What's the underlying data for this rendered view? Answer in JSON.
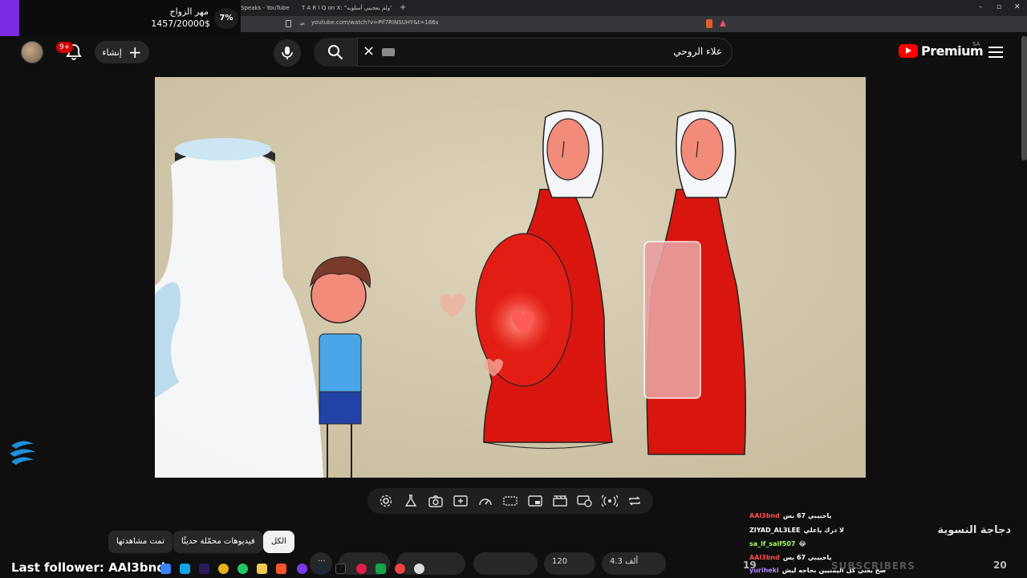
{
  "browser": {
    "tabs": [
      {
        "label": "Speaks - YouTube"
      },
      {
        "label": "T A R I Q on X: \"ولم يعجبني أسلوبه\""
      }
    ],
    "url": "youtube.com/watch?v=Pif7RINSUHY&t=166s"
  },
  "mahr_overlay": {
    "title": "مهر الزواج",
    "amount": "1457/20000$",
    "percent": "7%",
    "progress_fraction": 0.07
  },
  "masthead": {
    "notifications_badge": "9+",
    "create_label": "إنشاء",
    "search_value": "علاء الروحي",
    "logo_text": "Premium",
    "region": "SA"
  },
  "chips": {
    "all": "الكل",
    "recent": "فيديوهات محمّلة حديثًا",
    "watched": "تمت مشاهدتها"
  },
  "actions": {
    "like_count": "4.3 ألف",
    "comments_count": "120"
  },
  "channel": {
    "name": "دجاجة النسوية"
  },
  "chat": [
    {
      "user": "AAl3bnd",
      "message": "ياحبيبي 67 بس",
      "color": "#ff4d4d"
    },
    {
      "user": "ZIYAD_AL3LEE",
      "message": "لا درك ياعلي",
      "color": "#ffffff"
    },
    {
      "user": "sa_lf_saif507",
      "message": "😂",
      "color": "#a8ff60"
    },
    {
      "user": "AAl3bnd",
      "message": "ياحبيبي 67 بس",
      "color": "#ff4d4d"
    },
    {
      "user": "yuriheki",
      "message": "صح يعني كل اليمنيين بحاجه ليش",
      "color": "#b388ff"
    }
  ],
  "stream_overlay": {
    "last_follower": "Last follower: AAl3bnd",
    "subs_label": "SUBSCRIBERS",
    "subs_left": "19",
    "subs_right": "20"
  }
}
